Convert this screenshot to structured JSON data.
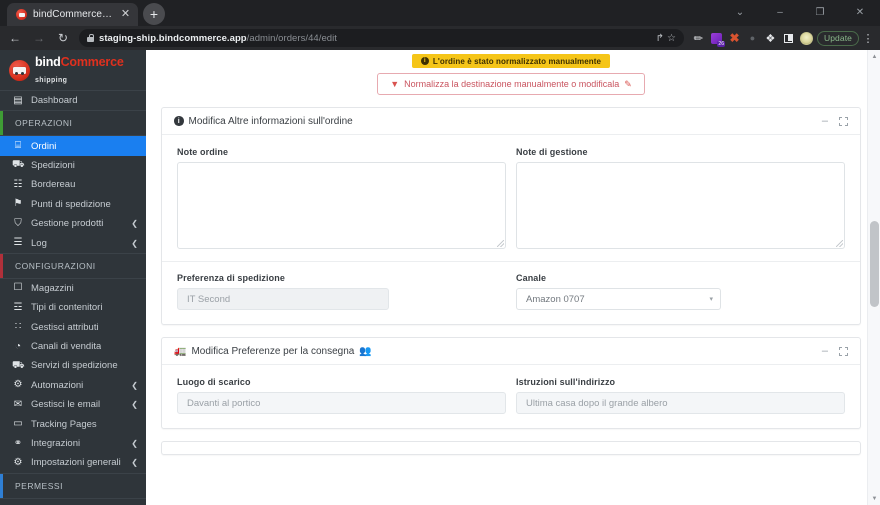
{
  "browser": {
    "tab": {
      "title": "bindCommerce shipping",
      "favicon": "bindcommerce-favicon",
      "close_label": "✕"
    },
    "newtab_label": "+",
    "window_controls": {
      "restore": "⌄",
      "minimize": "–",
      "maximize": "❐",
      "close": "✕"
    },
    "nav": {
      "back": "←",
      "forward": "→",
      "reload": "↻"
    },
    "omnibox": {
      "host": "staging-ship.bindcommerce.app",
      "path": "/admin/orders/44/edit",
      "share_icon": "↱",
      "bookmark_icon": "☆"
    },
    "extensions": [
      {
        "name": "pencil-extension",
        "glyph": "✎"
      },
      {
        "name": "purple-extension",
        "badge": "26"
      },
      {
        "name": "x-extension",
        "glyph": "✖"
      },
      {
        "name": "dot-extension",
        "glyph": "•"
      },
      {
        "name": "puzzle-extension",
        "glyph": "✦"
      },
      {
        "name": "sidepanel-extension",
        "glyph": ""
      },
      {
        "name": "profile-avatar",
        "glyph": ""
      }
    ],
    "update_button": "Update",
    "menu_icon": "⋮"
  },
  "sidebar": {
    "logo": {
      "bind": "bind",
      "commerce": "Commerce",
      "tagline": "shipping"
    },
    "top_items": [
      {
        "label": "Dashboard",
        "icon": "dashboard-icon",
        "glyph": "▤",
        "active": false,
        "caret": ""
      }
    ],
    "sections": [
      {
        "title": "OPERAZIONI",
        "accent": "green",
        "items": [
          {
            "label": "Ordini",
            "icon": "orders-icon",
            "glyph": "⌸",
            "active": true,
            "caret": ""
          },
          {
            "label": "Spedizioni",
            "icon": "truck-icon",
            "glyph": "⛟",
            "active": false,
            "caret": ""
          },
          {
            "label": "Bordereau",
            "icon": "document-icon",
            "glyph": "☷",
            "active": false,
            "caret": ""
          },
          {
            "label": "Punti di spedizione",
            "icon": "map-pin-icon",
            "glyph": "⚑",
            "active": false,
            "caret": ""
          },
          {
            "label": "Gestione prodotti",
            "icon": "cart-icon",
            "glyph": "⛉",
            "active": false,
            "caret": "❮"
          },
          {
            "label": "Log",
            "icon": "list-icon",
            "glyph": "☰",
            "active": false,
            "caret": "❮"
          }
        ]
      },
      {
        "title": "CONFIGURAZIONI",
        "accent": "red",
        "items": [
          {
            "label": "Magazzini",
            "icon": "warehouse-icon",
            "glyph": "☐",
            "active": false,
            "caret": ""
          },
          {
            "label": "Tipi di contenitori",
            "icon": "container-icon",
            "glyph": "☲",
            "active": false,
            "caret": ""
          },
          {
            "label": "Gestisci attributi",
            "icon": "attributes-icon",
            "glyph": "∷",
            "active": false,
            "caret": ""
          },
          {
            "label": "Canali di vendita",
            "icon": "pie-chart-icon",
            "glyph": "◔",
            "active": false,
            "caret": ""
          },
          {
            "label": "Servizi di spedizione",
            "icon": "shipping-icon",
            "glyph": "⛟",
            "active": false,
            "caret": ""
          },
          {
            "label": "Automazioni",
            "icon": "gears-icon",
            "glyph": "⚙",
            "active": false,
            "caret": "❮"
          },
          {
            "label": "Gestisci le email",
            "icon": "envelope-icon",
            "glyph": "✉",
            "active": false,
            "caret": "❮"
          },
          {
            "label": "Tracking Pages",
            "icon": "window-icon",
            "glyph": "▭",
            "active": false,
            "caret": ""
          },
          {
            "label": "Integrazioni",
            "icon": "link-icon",
            "glyph": "⚭",
            "active": false,
            "caret": "❮"
          },
          {
            "label": "Impostazioni generali",
            "icon": "gears-icon",
            "glyph": "⚙",
            "active": false,
            "caret": "❮"
          }
        ]
      },
      {
        "title": "PERMESSI",
        "accent": "blue",
        "items": []
      }
    ]
  },
  "main": {
    "alert_badge": "L'ordine è stato normalizzato manualmente",
    "normalize_button": "Normalizza la destinazione manualmente o modificala",
    "cards": [
      {
        "title": "Modifica Altre informazioni sull'ordine",
        "icon_leading": "info-icon",
        "icon_trailing": "",
        "fields": {
          "note_ordine_label": "Note ordine",
          "note_ordine_value": "",
          "note_gestione_label": "Note di gestione",
          "note_gestione_value": "",
          "preferenza_label": "Preferenza di spedizione",
          "preferenza_value": "IT Second",
          "canale_label": "Canale",
          "canale_value": "Amazon 0707",
          "canale_caret": "▾"
        }
      },
      {
        "title": "Modifica Preferenze per la consegna",
        "icon_leading": "truck-icon",
        "icon_trailing": "people-icon",
        "fields": {
          "luogo_label": "Luogo di scarico",
          "luogo_value": "Davanti al portico",
          "istruzioni_label": "Istruzioni sull'indirizzo",
          "istruzioni_value": "Ultima casa dopo il grande albero"
        }
      }
    ],
    "card_tools": {
      "minimize": "–",
      "expand": "expand-icon"
    }
  },
  "scrollbar": {
    "up": "▲",
    "down": "▼"
  },
  "colors": {
    "sidebar_bg": "#2f353a",
    "active_item": "#1a7ff0",
    "accent_green": "#3f9c35",
    "accent_red": "#b0303a",
    "brand_red": "#e0301e",
    "warning_yellow": "#f5c518",
    "danger_text": "#c9545f"
  }
}
